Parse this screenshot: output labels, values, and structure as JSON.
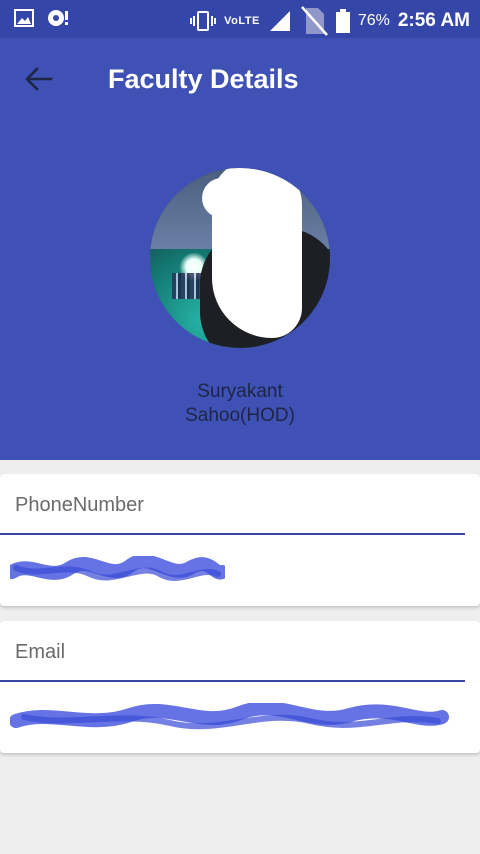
{
  "status_bar": {
    "network": "VoLTE",
    "battery": "76%",
    "time": "2:56 AM",
    "icons": [
      "gallery-icon",
      "data-saver-icon",
      "vibrate-icon",
      "signal-icon",
      "no-sim-icon",
      "battery-icon"
    ]
  },
  "header": {
    "title": "Faculty Details",
    "back_icon": "arrow-back-icon",
    "name_line1": "Suryakant",
    "name_line2": "Sahoo(HOD)"
  },
  "fields": {
    "phone_label": "PhoneNumber",
    "email_label": "Email"
  },
  "colors": {
    "primary": "#3f51b5",
    "status_bar": "#3446a8",
    "background": "#eeeeee",
    "underline": "#3646a5",
    "redaction": "#4a5be0"
  }
}
